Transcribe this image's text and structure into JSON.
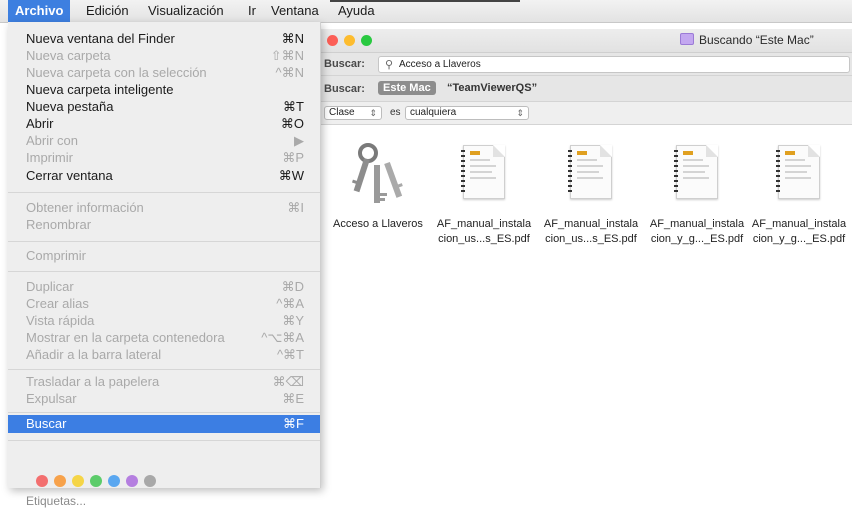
{
  "menubar": {
    "items": [
      "Archivo",
      "Edición",
      "Visualización",
      "Ir",
      "Ventana",
      "Ayuda"
    ],
    "active_index": 0
  },
  "file_menu": {
    "items": [
      {
        "label": "Nueva ventana del Finder",
        "shortcut": "⌘N",
        "enabled": true
      },
      {
        "label": "Nueva carpeta",
        "shortcut": "⇧⌘N",
        "enabled": false
      },
      {
        "label": "Nueva carpeta con la selección",
        "shortcut": "^⌘N",
        "enabled": false
      },
      {
        "label": "Nueva carpeta inteligente",
        "shortcut": "",
        "enabled": true
      },
      {
        "label": "Nueva pestaña",
        "shortcut": "⌘T",
        "enabled": true
      },
      {
        "label": "Abrir",
        "shortcut": "⌘O",
        "enabled": true
      },
      {
        "label": "Abrir con",
        "shortcut": "▶",
        "enabled": false
      },
      {
        "label": "Imprimir",
        "shortcut": "⌘P",
        "enabled": false
      },
      {
        "label": "Cerrar ventana",
        "shortcut": "⌘W",
        "enabled": true
      },
      {
        "label": "Obtener información",
        "shortcut": "⌘I",
        "enabled": false
      },
      {
        "label": "Renombrar",
        "shortcut": "",
        "enabled": false
      },
      {
        "label": "Comprimir",
        "shortcut": "",
        "enabled": false
      },
      {
        "label": "Duplicar",
        "shortcut": "⌘D",
        "enabled": false
      },
      {
        "label": "Crear alias",
        "shortcut": "^⌘A",
        "enabled": false
      },
      {
        "label": "Vista rápida",
        "shortcut": "⌘Y",
        "enabled": false
      },
      {
        "label": "Mostrar en la carpeta contenedora",
        "shortcut": "^⌥⌘A",
        "enabled": false
      },
      {
        "label": "Añadir a la barra lateral",
        "shortcut": "^⌘T",
        "enabled": false
      },
      {
        "label": "Trasladar a la papelera",
        "shortcut": "⌘⌫",
        "enabled": false
      },
      {
        "label": "Expulsar",
        "shortcut": "⌘E",
        "enabled": false
      },
      {
        "label": "Buscar",
        "shortcut": "⌘F",
        "enabled": true,
        "highlighted": true
      }
    ],
    "tag_colors": [
      "#f36f6f",
      "#f7a24b",
      "#f5d547",
      "#5ccc6a",
      "#5aa7f0",
      "#b57fe0",
      "#a8a8a8"
    ],
    "tags_label": "Etiquetas..."
  },
  "finder": {
    "title": "Buscando “Este Mac”",
    "search_label": "Buscar:",
    "search_value": "Acceso a Llaveros",
    "scope_label": "Buscar:",
    "scope_active": "Este Mac",
    "scope_other": "“TeamViewerQS”",
    "criteria": {
      "attribute": "Clase",
      "operator": "es",
      "value": "cualquiera"
    },
    "results": [
      {
        "line1": "Acceso a Llaveros",
        "line2": "",
        "icon": "keychain-icon"
      },
      {
        "line1": "AF_manual_instala",
        "line2": "cion_us...s_ES.pdf",
        "icon": "pdf-document-icon"
      },
      {
        "line1": "AF_manual_instala",
        "line2": "cion_us...s_ES.pdf",
        "icon": "pdf-document-icon"
      },
      {
        "line1": "AF_manual_instala",
        "line2": "cion_y_g..._ES.pdf",
        "icon": "pdf-document-icon"
      },
      {
        "line1": "AF_manual_instala",
        "line2": "cion_y_g..._ES.pdf",
        "icon": "pdf-document-icon"
      }
    ]
  }
}
